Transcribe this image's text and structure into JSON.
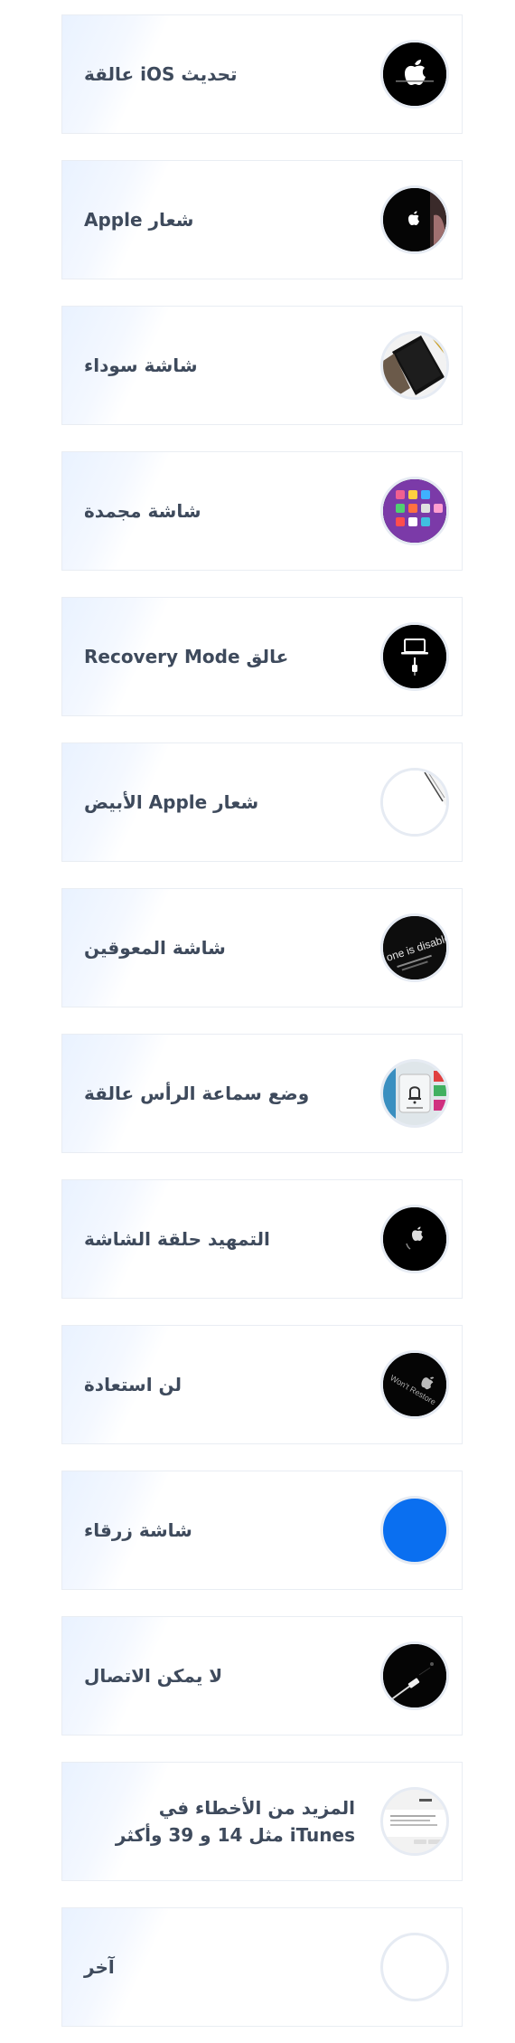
{
  "items": [
    {
      "label": "تحديث iOS عالقة",
      "icon": "apple-logo-icon"
    },
    {
      "label": "شعار Apple",
      "icon": "iphone-apple-logo-icon"
    },
    {
      "label": "شاشة سوداء",
      "icon": "black-screen-phone-icon"
    },
    {
      "label": "شاشة مجمدة",
      "icon": "frozen-screen-apps-icon"
    },
    {
      "label": "عالق Recovery Mode",
      "icon": "recovery-mode-icon"
    },
    {
      "label": "شعار Apple الأبيض",
      "icon": "white-apple-screen-icon"
    },
    {
      "label": "شاشة المعوقين",
      "icon": "disabled-screen-icon",
      "icon_text": "one is disable"
    },
    {
      "label": "وضع سماعة الرأس عالقة",
      "icon": "headphone-mode-icon"
    },
    {
      "label": "التمهيد حلقة الشاشة",
      "icon": "boot-loop-icon"
    },
    {
      "label": "لن استعادة",
      "icon": "wont-restore-icon",
      "icon_text": "Won't Restore"
    },
    {
      "label": "شاشة زرقاء",
      "icon": "blue-screen-icon"
    },
    {
      "label": "لا يمكن الاتصال",
      "icon": "cannot-connect-icon"
    },
    {
      "label": "المزيد من الأخطاء في iTunes مثل 14 و 39 وأكثر",
      "icon": "itunes-error-icon"
    },
    {
      "label": "آخر",
      "icon": "other-icon"
    }
  ],
  "colors": {
    "label": "#3e4a5c",
    "blue_screen": "#0a6ff0",
    "card_border": "#e9edf3"
  }
}
